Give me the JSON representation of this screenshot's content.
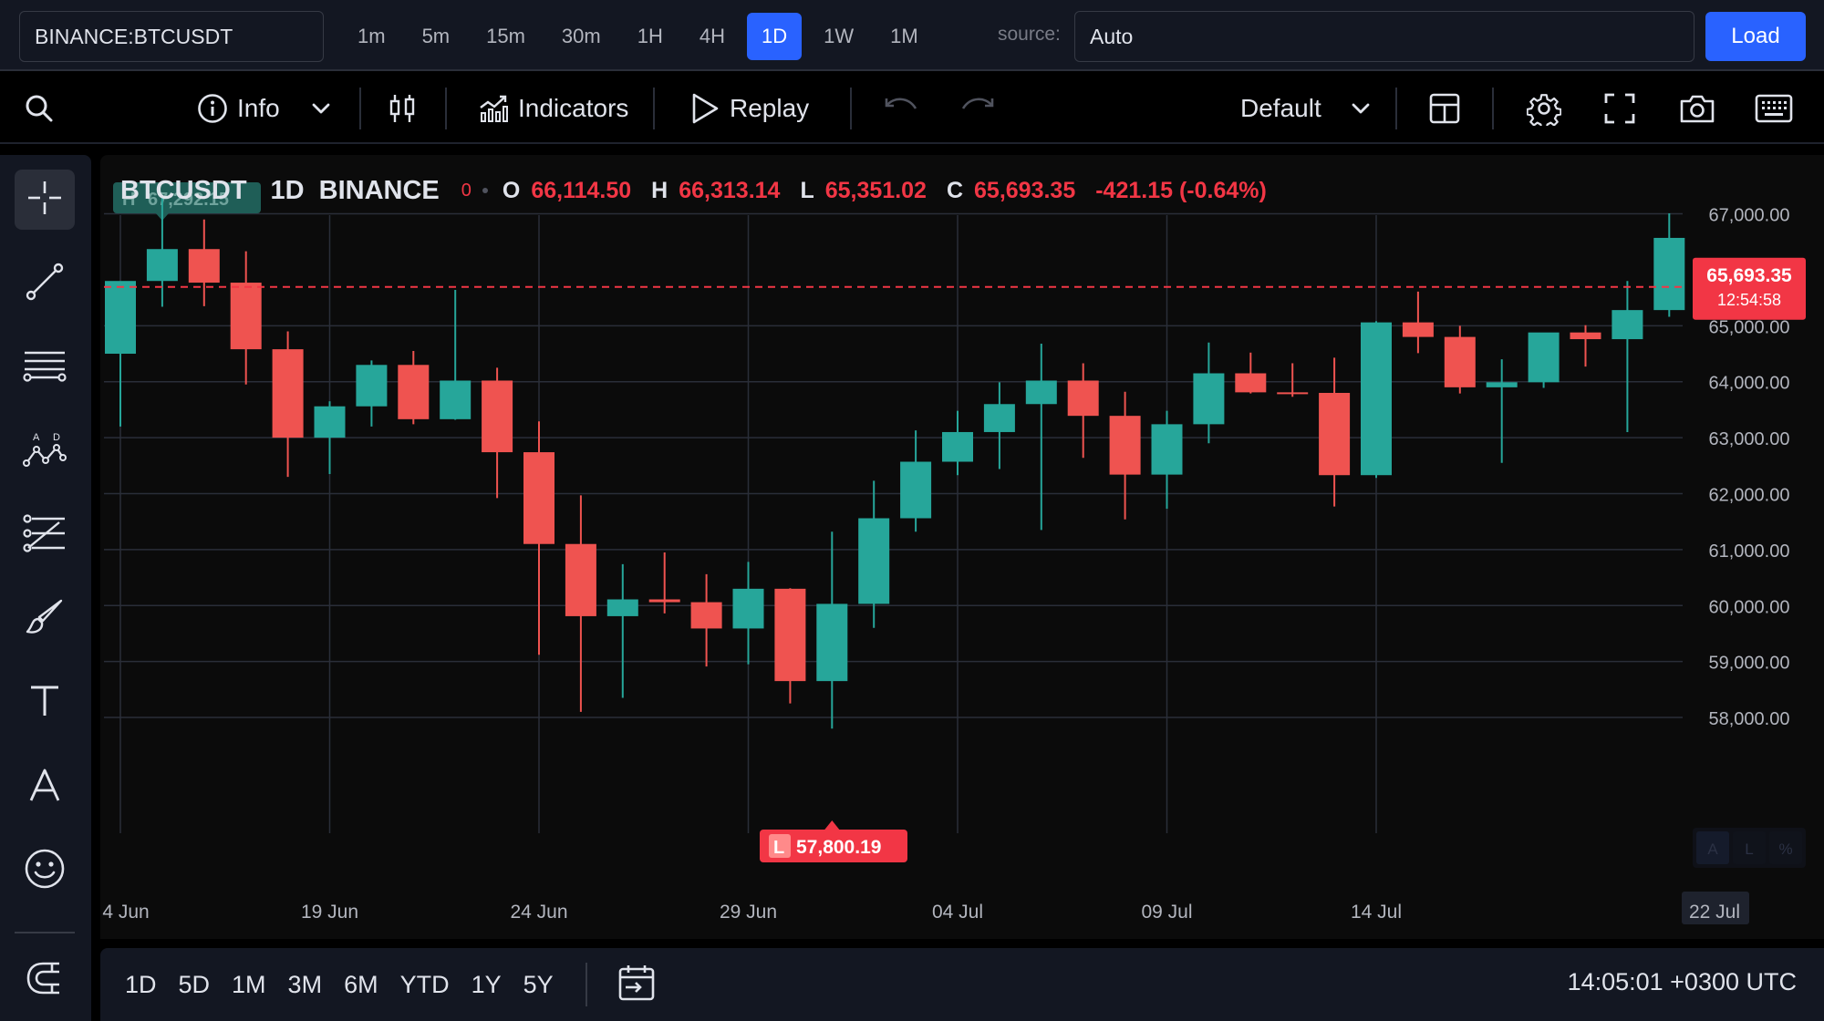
{
  "topbar": {
    "symbol_value": "BINANCE:BTCUSDT",
    "intervals": [
      "1m",
      "5m",
      "15m",
      "30m",
      "1H",
      "4H",
      "1D",
      "1W",
      "1M"
    ],
    "active_interval": "1D",
    "source_label": "source:",
    "source_value": "Auto",
    "load_label": "Load"
  },
  "toolbar": {
    "info_label": "Info",
    "indicators_label": "Indicators",
    "replay_label": "Replay",
    "layout_label": "Default"
  },
  "legend": {
    "symbol": "BTCUSDT",
    "timeframe": "1D",
    "exchange": "BINANCE",
    "zero": "0",
    "o_key": "O",
    "o_val": "66,114.50",
    "h_key": "H",
    "h_val": "66,313.14",
    "l_key": "L",
    "l_val": "65,351.02",
    "c_key": "C",
    "c_val": "65,693.35",
    "change": "-421.15 (-0.64%)"
  },
  "colors": {
    "up": "#26a69a",
    "down": "#ef5350",
    "accent": "#2962ff",
    "last_price": "#f23645"
  },
  "chart_data": {
    "type": "candlestick",
    "title": "",
    "xlabel": "",
    "ylabel": "",
    "ylim": [
      57300,
      67400
    ],
    "y_ticks": [
      "67,000.00",
      "65,000.00",
      "64,000.00",
      "63,000.00",
      "62,000.00",
      "61,000.00",
      "60,000.00",
      "59,000.00",
      "58,000.00"
    ],
    "y_tick_values": [
      67000,
      65000,
      64000,
      63000,
      62000,
      61000,
      60000,
      59000,
      58000
    ],
    "x_ticks": [
      "4 Jun",
      "19 Jun",
      "24 Jun",
      "29 Jun",
      "04 Jul",
      "09 Jul",
      "14 Jul",
      "22 Jul"
    ],
    "x_tick_index": [
      0,
      5,
      10,
      15,
      20,
      25,
      30,
      38
    ],
    "candles": [
      {
        "o": 64500,
        "h": 65700,
        "l": 63200,
        "c": 65800
      },
      {
        "o": 65800,
        "h": 67300,
        "l": 65340,
        "c": 66370
      },
      {
        "o": 66370,
        "h": 66900,
        "l": 65350,
        "c": 65770
      },
      {
        "o": 65770,
        "h": 66330,
        "l": 63950,
        "c": 64580
      },
      {
        "o": 64580,
        "h": 64900,
        "l": 62300,
        "c": 63000
      },
      {
        "o": 63000,
        "h": 63650,
        "l": 62350,
        "c": 63560
      },
      {
        "o": 63560,
        "h": 64380,
        "l": 63200,
        "c": 64300
      },
      {
        "o": 64300,
        "h": 64550,
        "l": 63240,
        "c": 63330
      },
      {
        "o": 63330,
        "h": 65640,
        "l": 63320,
        "c": 64020
      },
      {
        "o": 64020,
        "h": 64250,
        "l": 61920,
        "c": 62740
      },
      {
        "o": 62740,
        "h": 63290,
        "l": 59120,
        "c": 61100
      },
      {
        "o": 61100,
        "h": 61970,
        "l": 58100,
        "c": 59810
      },
      {
        "o": 59810,
        "h": 60740,
        "l": 58350,
        "c": 60110
      },
      {
        "o": 60110,
        "h": 60950,
        "l": 59860,
        "c": 60060
      },
      {
        "o": 60060,
        "h": 60560,
        "l": 58910,
        "c": 59590
      },
      {
        "o": 59590,
        "h": 60780,
        "l": 58950,
        "c": 60300
      },
      {
        "o": 60300,
        "h": 60310,
        "l": 58250,
        "c": 58650
      },
      {
        "o": 58650,
        "h": 61320,
        "l": 57800,
        "c": 60030
      },
      {
        "o": 60030,
        "h": 62230,
        "l": 59600,
        "c": 61560
      },
      {
        "o": 61560,
        "h": 63130,
        "l": 61320,
        "c": 62570
      },
      {
        "o": 62570,
        "h": 63480,
        "l": 62330,
        "c": 63100
      },
      {
        "o": 63100,
        "h": 63990,
        "l": 62440,
        "c": 63600
      },
      {
        "o": 63600,
        "h": 64680,
        "l": 61350,
        "c": 64020
      },
      {
        "o": 64020,
        "h": 64330,
        "l": 62640,
        "c": 63390
      },
      {
        "o": 63390,
        "h": 63820,
        "l": 61540,
        "c": 62340
      },
      {
        "o": 62340,
        "h": 63480,
        "l": 61730,
        "c": 63240
      },
      {
        "o": 63240,
        "h": 64700,
        "l": 62900,
        "c": 64150
      },
      {
        "o": 64150,
        "h": 64520,
        "l": 63790,
        "c": 63810
      },
      {
        "o": 63810,
        "h": 64330,
        "l": 63730,
        "c": 63800
      },
      {
        "o": 63800,
        "h": 64430,
        "l": 61770,
        "c": 62330
      },
      {
        "o": 62330,
        "h": 65080,
        "l": 62280,
        "c": 65060
      },
      {
        "o": 65060,
        "h": 65610,
        "l": 64510,
        "c": 64800
      },
      {
        "o": 64800,
        "h": 65000,
        "l": 63790,
        "c": 63900
      },
      {
        "o": 63900,
        "h": 64400,
        "l": 62550,
        "c": 63990
      },
      {
        "o": 63990,
        "h": 64860,
        "l": 63890,
        "c": 64880
      },
      {
        "o": 64880,
        "h": 65010,
        "l": 64270,
        "c": 64760
      },
      {
        "o": 64760,
        "h": 65800,
        "l": 63100,
        "c": 65280
      },
      {
        "o": 65280,
        "h": 67010,
        "l": 65160,
        "c": 66570
      }
    ],
    "high_marker": {
      "label": "H",
      "value": "67,292.15",
      "index": 1,
      "price": 67292.15
    },
    "low_marker": {
      "label": "L",
      "value": "57,800.19",
      "index": 17,
      "price": 57800.19
    },
    "last_price": {
      "value": "65,693.35",
      "countdown": "12:54:58",
      "price": 65693.35
    },
    "scale_buttons": [
      "A",
      "L",
      "%"
    ]
  },
  "bottombar": {
    "ranges": [
      "1D",
      "5D",
      "1M",
      "3M",
      "6M",
      "YTD",
      "1Y",
      "5Y"
    ],
    "clock": "14:05:01 +0300 UTC"
  }
}
